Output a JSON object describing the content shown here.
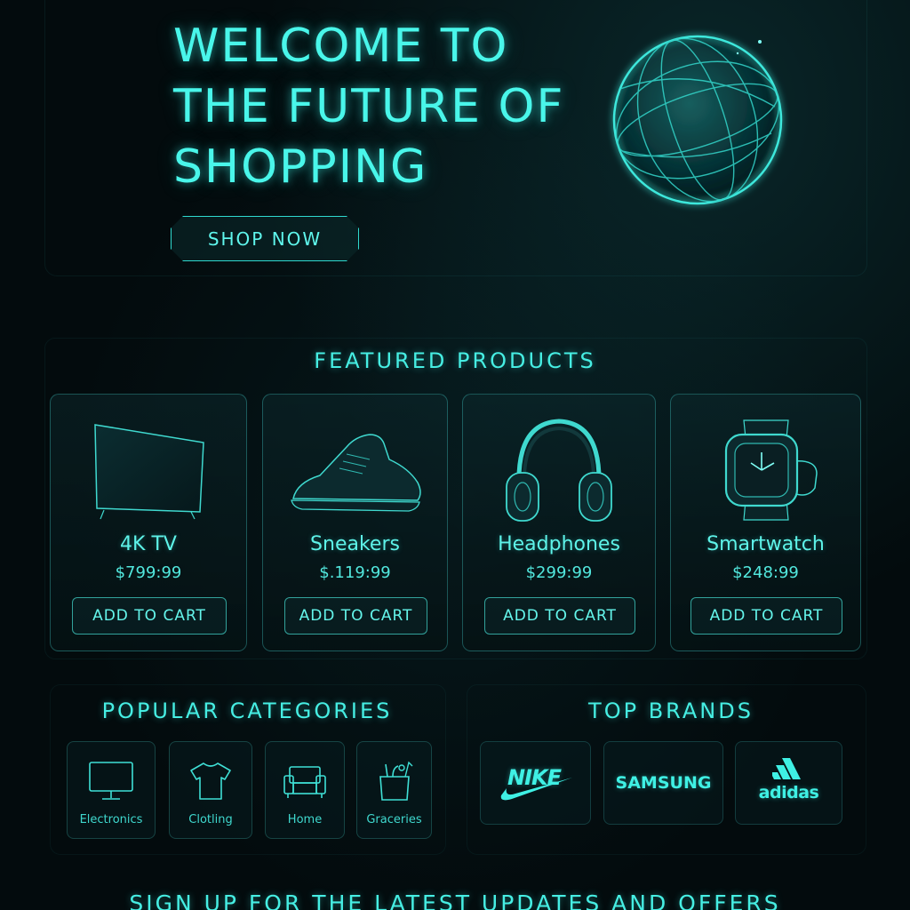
{
  "hero": {
    "title_lines": [
      "WELCOME TO",
      "THE FUTURE OF",
      "SHOPPING"
    ],
    "cta_label": "SHOP NOW",
    "globe_icon": "globe-icon"
  },
  "featured": {
    "title": "FEATURED PRODUCTS",
    "products": [
      {
        "name": "4K TV",
        "price": "$799:99",
        "button": "ADD TO CART",
        "icon": "tv-icon"
      },
      {
        "name": "Sneakers",
        "price": "$.119:99",
        "button": "ADD TO CART",
        "icon": "sneaker-icon"
      },
      {
        "name": "Headphones",
        "price": "$299:99",
        "button": "ADD TO CART",
        "icon": "headphones-icon"
      },
      {
        "name": "Smartwatch",
        "price": "$248:99",
        "button": "ADD TO CART",
        "icon": "smartwatch-icon"
      }
    ]
  },
  "categories": {
    "title": "POPULAR CATEGORIES",
    "items": [
      {
        "label": "Electronics",
        "icon": "monitor-icon"
      },
      {
        "label": "Clotling",
        "icon": "tshirt-icon"
      },
      {
        "label": "Home",
        "icon": "sofa-icon"
      },
      {
        "label": "Graceries",
        "icon": "grocery-bag-icon"
      }
    ]
  },
  "brands": {
    "title": "TOP BRANDS",
    "items": [
      {
        "label": "NIKE"
      },
      {
        "label": "SAMSUNG"
      },
      {
        "label": "adidas"
      }
    ]
  },
  "signup": {
    "text": "SIGN UP FOR THE LATEST UPDATES AND OFFERS"
  },
  "colors": {
    "accent": "#3ff0e4",
    "background": "#030b0d",
    "card_border": "#2fbdb5"
  }
}
